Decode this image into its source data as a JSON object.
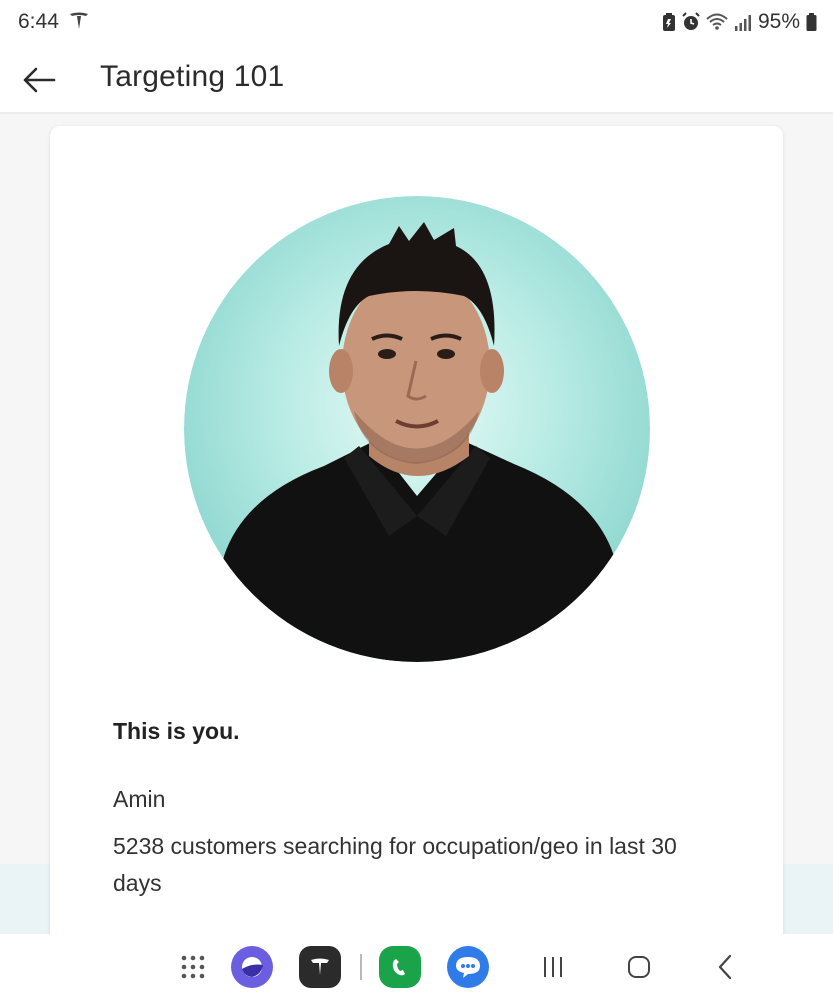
{
  "status_bar": {
    "time": "6:44",
    "battery": "95%",
    "icons": [
      "tesla-icon",
      "battery-saver-icon",
      "alarm-icon",
      "wifi-icon",
      "signal-icon",
      "battery-icon"
    ]
  },
  "app_bar": {
    "title": "Targeting 101",
    "back_icon": "arrow-left-icon"
  },
  "card": {
    "heading": "This is you.",
    "name": "Amin",
    "description": "5238 customers searching for occupation/geo in last 30 days",
    "avatar_bg": "#8fd8d0"
  },
  "nav_bar": {
    "apps": [
      "app-drawer-icon",
      "internet-browser-icon",
      "tesla-app-icon",
      "phone-app-icon",
      "messages-app-icon"
    ],
    "buttons": [
      "recents-button",
      "home-button",
      "back-button"
    ]
  },
  "colors": {
    "browser": "#6b5ee0",
    "tesla_app": "#2b2b2b",
    "phone_app": "#1ba34a",
    "messages_app": "#2f7ce8"
  }
}
